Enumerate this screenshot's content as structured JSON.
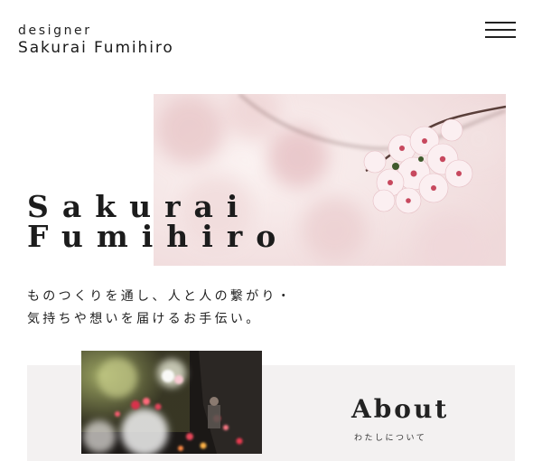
{
  "header": {
    "logo_line1": "designer",
    "logo_line2": "Sakurai Fumihiro",
    "menu_icon": "hamburger-menu-icon"
  },
  "hero": {
    "image": "cherry-blossom-photo",
    "title_line1": "Sakurai",
    "title_line2": "Fumihiro",
    "tagline_line1": "ものつくりを通し、人と人の繋がり・",
    "tagline_line2": "気持ちや想いを届けるお手伝い。"
  },
  "about": {
    "image": "digital-art-flowers-photo",
    "heading": "About",
    "subheading": "わたしについて"
  },
  "colors": {
    "text": "#1f1f1f",
    "section_bg": "#f3f1f1",
    "blossom_pink": "#f2d6dc"
  }
}
